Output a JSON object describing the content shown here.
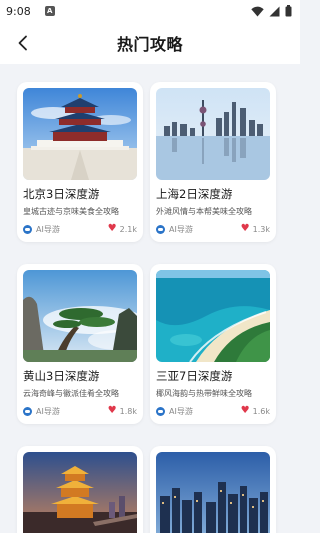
{
  "status": {
    "time": "9:08",
    "notification": "A"
  },
  "nav": {
    "title": "热门攻略"
  },
  "cards": [
    {
      "title": "北京3日深度游",
      "subtitle": "皇城古迹与京味美食全攻略",
      "source": "AI导游",
      "likes": "2.1k",
      "image": "temple-of-heaven"
    },
    {
      "title": "上海2日深度游",
      "subtitle": "外滩风情与本帮美味全攻略",
      "source": "AI导游",
      "likes": "1.3k",
      "image": "shanghai-skyline"
    },
    {
      "title": "黄山3日深度游",
      "subtitle": "云海奇峰与徽派佳肴全攻略",
      "source": "AI导游",
      "likes": "1.8k",
      "image": "huangshan-pine"
    },
    {
      "title": "三亚7日深度游",
      "subtitle": "椰风海韵与热带鲜味全攻略",
      "source": "AI导游",
      "likes": "1.6k",
      "image": "sanya-beach"
    },
    {
      "image": "yellow-crane-tower"
    },
    {
      "image": "city-night-skyline"
    }
  ],
  "colors": {
    "accent": "#2b74c8",
    "like": "#e0384b",
    "background": "#f1f3f7"
  }
}
